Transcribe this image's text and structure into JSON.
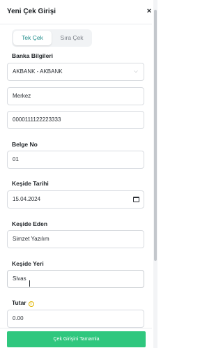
{
  "header": {
    "title": "Yeni Çek Girişi",
    "close_glyph": "×"
  },
  "tabs": [
    {
      "label": "Tek Çek",
      "active": true
    },
    {
      "label": "Sıra Çek",
      "active": false
    }
  ],
  "form": {
    "bank_section_label": "Banka Bilgileri",
    "bank_select_value": "AKBANK - AKBANK",
    "branch_value": "Merkez",
    "account_value": "0000111122223333",
    "document_no_label": "Belge No",
    "document_no_value": "01",
    "issue_date_label": "Keşide Tarihi",
    "issue_date_value": "15.04.2024",
    "drawer_label": "Keşide Eden",
    "drawer_value": "Simzet Yazılım",
    "issue_place_label": "Keşide Yeri",
    "issue_place_value": "Sivas",
    "amount_label": "Tutar",
    "amount_value": "0.00"
  },
  "icons": {
    "chevron": "chevron-down-icon",
    "calendar": "calendar-icon",
    "info": "info-icon",
    "close": "close-icon"
  },
  "footer": {
    "submit_label": "Çek Girişini Tamamla"
  },
  "colors": {
    "accent": "#1e8c8a",
    "submit": "#2fc77e",
    "info": "#e0b400"
  }
}
